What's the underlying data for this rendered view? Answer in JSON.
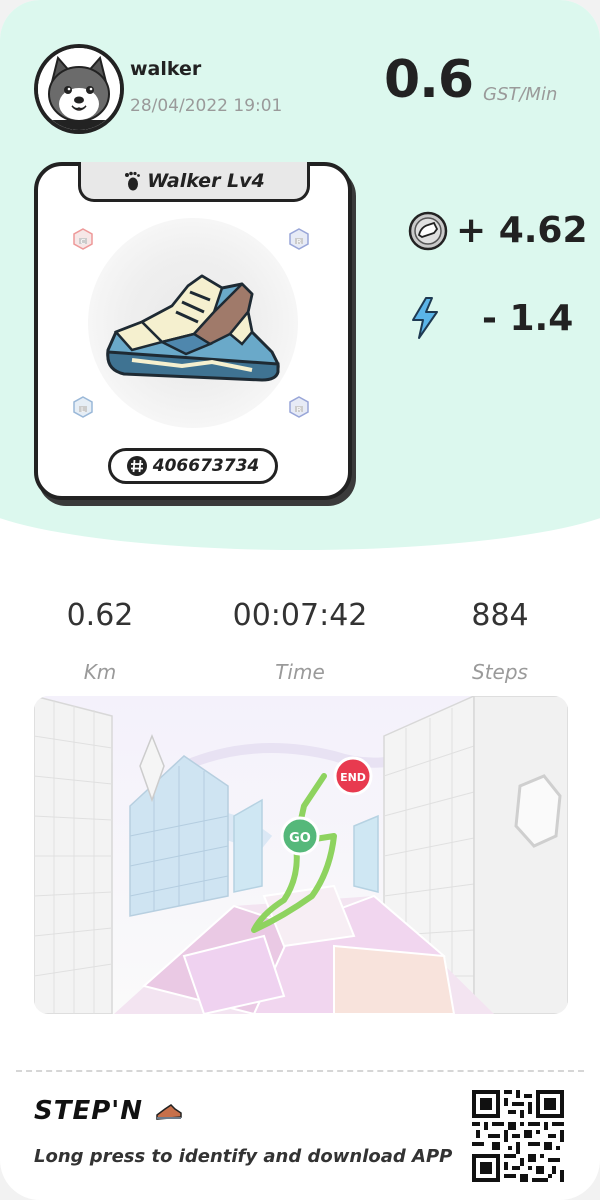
{
  "user": {
    "name": "walker",
    "datetime": "28/04/2022 19:01",
    "avatar_icon": "shiba-dog-avatar-icon"
  },
  "earning_rate": {
    "value": "0.6",
    "unit": "GST/Min"
  },
  "sneaker": {
    "title": "Walker Lv4",
    "title_icon": "footprint-icon",
    "id": "406673734",
    "id_icon": "hash-icon",
    "sockets": [
      "C",
      "R",
      "L",
      "R"
    ],
    "sneaker_icon": "sneaker-icon"
  },
  "gains": {
    "gst": {
      "value": "+ 4.62",
      "icon": "gst-coin-icon"
    },
    "energy": {
      "value": "- 1.4",
      "icon": "lightning-icon"
    }
  },
  "stats": [
    {
      "value": "0.62",
      "label": "Km"
    },
    {
      "value": "00:07:42",
      "label": "Time"
    },
    {
      "value": "884",
      "label": "Steps"
    }
  ],
  "map": {
    "start_label": "GO",
    "end_label": "END"
  },
  "footer": {
    "brand": "STEP'N",
    "brand_icon": "sneaker-logo-icon",
    "text": "Long press to identify and download APP",
    "qr_icon": "qr-code-icon"
  },
  "colors": {
    "mint_background": "#dcf8ee",
    "route_green": "#8ed35f",
    "start_marker": "#55b87a",
    "end_marker": "#e83a4f",
    "energy_blue": "#5bb5e8"
  }
}
